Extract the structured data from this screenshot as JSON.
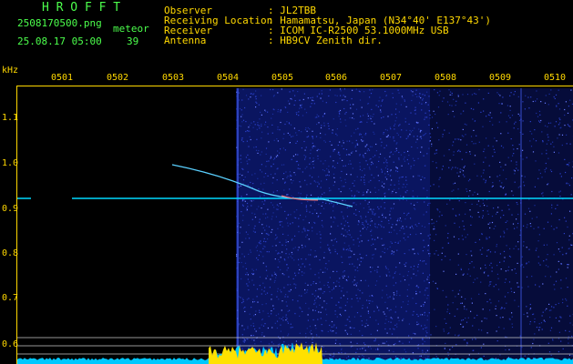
{
  "header": {
    "logo": "H R O F F T",
    "filename": "2508170500.png",
    "datetime": "25.08.17 05:00",
    "meteor_label": "meteor",
    "meteor_count": "39"
  },
  "info": {
    "labels": [
      "Observer",
      "Receiving Location",
      "Receiver",
      "Antenna"
    ],
    "values": [
      ": JL2TBB",
      ": Hamamatsu, Japan (N34°40' E137°43')",
      ": ICOM IC-R2500 53.1000MHz USB",
      ": HB9CV Zenith dir."
    ]
  },
  "axis": {
    "unit": "kHz",
    "x_ticks": [
      "0501",
      "0502",
      "0503",
      "0504",
      "0505",
      "0506",
      "0507",
      "0508",
      "0509",
      "0510"
    ],
    "y_ticks": [
      "1.1",
      "1.0",
      "0.9",
      "0.8",
      "0.7",
      "0.6"
    ]
  },
  "colors": {
    "title_green": "#4cff4c",
    "label_yellow": "#ffd800",
    "signal_blue": "#00d8ff",
    "noise_blue": "#1a2fa0"
  }
}
